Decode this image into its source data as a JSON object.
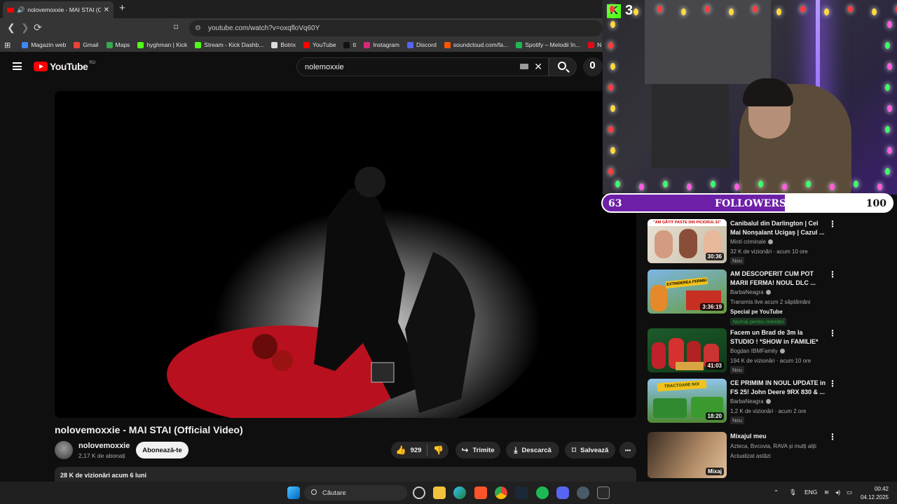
{
  "browser": {
    "tab_title": "nolovemoxxie - MAI STAI (Off",
    "tab_speaker": "🔊",
    "tab_close": "✕",
    "new_tab": "+",
    "url": "youtube.com/watch?v=oxqfloVq60Y",
    "bookmarks": [
      {
        "label": "Magazin web",
        "color": "#4285f4"
      },
      {
        "label": "Gmail",
        "color": "#ea4335"
      },
      {
        "label": "Maps",
        "color": "#34a853"
      },
      {
        "label": "hyghman | Kick",
        "color": "#53fc18"
      },
      {
        "label": "Stream - Kick Dashb...",
        "color": "#53fc18"
      },
      {
        "label": "Botrix",
        "color": "#dddddd"
      },
      {
        "label": "YouTube",
        "color": "#ff0000"
      },
      {
        "label": "tt",
        "color": "#111111"
      },
      {
        "label": "Instagram",
        "color": "#d62976"
      },
      {
        "label": "Discord",
        "color": "#5865f2"
      },
      {
        "label": "soundcloud.com/fa...",
        "color": "#ff5500"
      },
      {
        "label": "Spotify – Melodii în...",
        "color": "#1db954"
      },
      {
        "label": "N",
        "color": "#e50914"
      }
    ]
  },
  "youtube": {
    "logo_text": "YouTube",
    "country_code": "RO",
    "search_value": "nolemoxxie",
    "video_title": "nolovemoxxie - MAI STAI (Official Video)",
    "channel_name": "nolovemoxxie",
    "subscribers": "2,17 K de abonați",
    "subscribe_label": "Abonează-te",
    "likes": "929",
    "share_label": "Trimite",
    "download_label": "Descarcă",
    "save_label": "Salvează",
    "more_label": "•••",
    "description_meta": "28 K de vizionări  acum 6 luni"
  },
  "stream_overlay": {
    "platform_badge": "K",
    "viewer_count": "3",
    "followers_current": "63",
    "followers_label": "FOLLOWERS",
    "followers_goal": "100",
    "progress_fraction": 0.63
  },
  "recommended": [
    {
      "title": "Canibalul din Darlington | Cel Mai Nonșalant Ucigaș | Cazul ...",
      "channel": "Minti criminale",
      "meta": "32 K de vizionări · acum 10 ore",
      "badge": "Nou",
      "duration": "30:36",
      "thumb_caption": "\"AM GĂTIT PASTE DIN PICIORUL EI\""
    },
    {
      "title": "AM DESCOPERIT CUM POT MARII FERMA! NOUL DLC ...",
      "channel": "BarbaNeagra",
      "meta": "Transmis live acum 2 săptămâni",
      "special": "Special pe YouTube",
      "members": "Numai pentru membri",
      "duration": "3:36:19",
      "thumb_caption": "EXTINDEREA FERMEI"
    },
    {
      "title": "Facem un Brad de 3m la STUDIO ! *SHOW in FAMILIE*",
      "channel": "Bogdan IBMFamily",
      "meta": "194 K de vizionări · acum 10 ore",
      "badge": "Nou",
      "duration": "41:03"
    },
    {
      "title": "CE PRIMIM IN NOUL UPDATE in FS 25! John Deere 9RX 830 & ...",
      "channel": "BarbaNeagra",
      "meta": "1,2 K de vizionări · acum 2 ore",
      "badge": "Nou",
      "duration": "18:20",
      "thumb_caption": "TRACTOARE NOI"
    },
    {
      "title": "Mixajul meu",
      "channel": "Azteca, Bvcovia, RAVA și mulți alții",
      "meta": "Actualizat astăzi",
      "duration": "Mixaj"
    }
  ],
  "taskbar": {
    "search_label": "Căutare",
    "language": "ENG",
    "time": "00:42",
    "date": "04.12.2025"
  }
}
